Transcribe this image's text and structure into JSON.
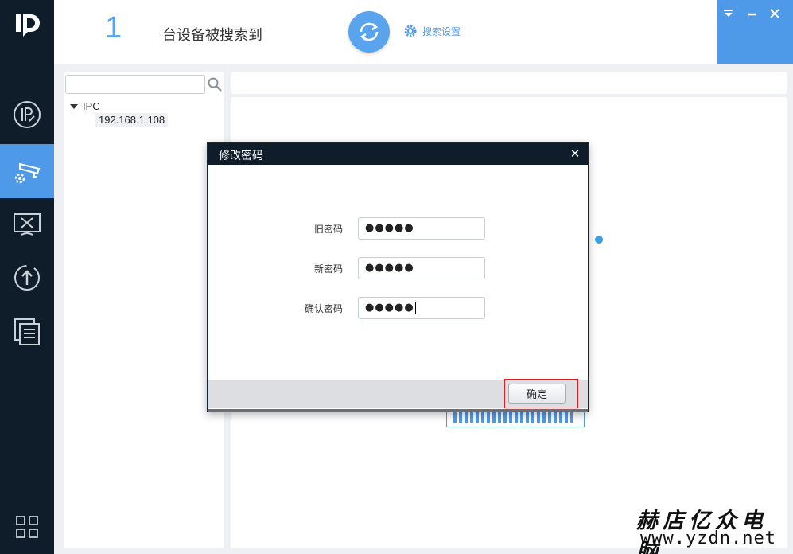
{
  "header": {
    "device_count": "1",
    "count_label": "台设备被搜索到",
    "search_settings_label": "搜索设置",
    "accent": "#4f9ae8"
  },
  "window_controls": [
    "menu-icon",
    "minimize-icon",
    "close-icon"
  ],
  "sidebar": {
    "icons": [
      "app-logo-icon",
      "ip-edit-icon",
      "camera-settings-icon",
      "tools-icon",
      "upgrade-icon",
      "document-list-icon",
      "apps-grid-icon"
    ],
    "active_index": 1
  },
  "tree": {
    "search_placeholder": "",
    "root_label": "IPC",
    "child_label": "192.168.1.108"
  },
  "dialog": {
    "title": "修改密码",
    "old_password_label": "旧密码",
    "old_password_value": "●●●●●",
    "new_password_label": "新密码",
    "new_password_value": "●●●●●",
    "confirm_password_label": "确认密码",
    "confirm_password_value": "●●●●●",
    "ok_label": "确定"
  },
  "watermark": {
    "cn": "赫店亿众电脑",
    "url": "www.yzdn.net"
  }
}
